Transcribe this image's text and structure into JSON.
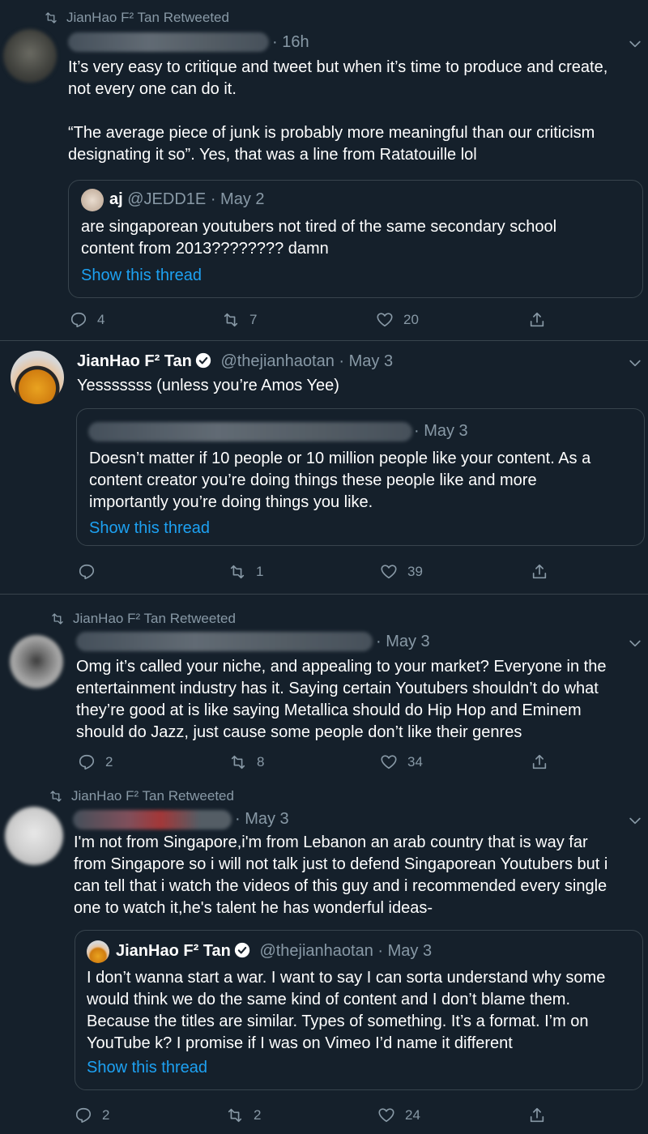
{
  "retweet_label": "JianHao F² Tan Retweeted",
  "tweets": [
    {
      "time": "· 16h",
      "body": "It’s very easy to critique and tweet but when it’s time to produce and create,\nnot every one can do it.\n\n“The average piece of junk is probably more meaningful than our criticism\ndesignating it so”. Yes, that was a line from Ratatouille lol",
      "quote": {
        "name": "aj",
        "handle": "@JEDD1E",
        "time": "· May 2",
        "body": "are singaporean youtubers not tired of the same secondary school\ncontent from 2013???????? damn",
        "link": "Show this thread"
      },
      "replies": "4",
      "retweets": "7",
      "likes": "20"
    },
    {
      "name": "JianHao F² Tan",
      "handle": "@thejianhaotan",
      "time": "· May 3",
      "body": "Yesssssss (unless you’re Amos Yee)",
      "quote": {
        "time": "· May 3",
        "body": "Doesn’t matter if 10 people or 10 million people like your content. As a\ncontent creator you’re doing things these people like and more\nimportantly you’re doing things you like.",
        "link": "Show this thread"
      },
      "replies": "",
      "retweets": "1",
      "likes": "39"
    },
    {
      "time": "· May 3",
      "body": "Omg it’s called your niche, and appealing to your market? Everyone in the\nentertainment industry has it. Saying certain Youtubers shouldn’t do what\nthey’re good at is like saying Metallica should do Hip Hop and Eminem\nshould do Jazz, just cause some people don’t like their genres",
      "replies": "2",
      "retweets": "8",
      "likes": "34"
    },
    {
      "time": "· May 3",
      "body": "I'm not from Singapore,i'm from Lebanon an arab country that is way far\nfrom Singapore so i will not talk just to defend Singaporean Youtubers but i\ncan tell that i watch the videos of this guy and i recommended every single\none to watch it,he's talent he has wonderful ideas-",
      "quote": {
        "name": "JianHao F² Tan",
        "handle": "@thejianhaotan",
        "time": "· May 3",
        "body": "I don’t wanna start a war. I want to say I can sorta understand why some\nwould think we do the same kind of content and I don’t blame them.\nBecause the titles are similar. Types of something. It’s a format. I’m on\nYouTube k? I promise if I was on Vimeo I’d name it different",
        "link": "Show this thread"
      },
      "replies": "2",
      "retweets": "2",
      "likes": "24"
    }
  ],
  "colors": {
    "background": "#15202b",
    "secondary_text": "#8899a6",
    "link": "#1da1f2",
    "border": "#38444d"
  }
}
